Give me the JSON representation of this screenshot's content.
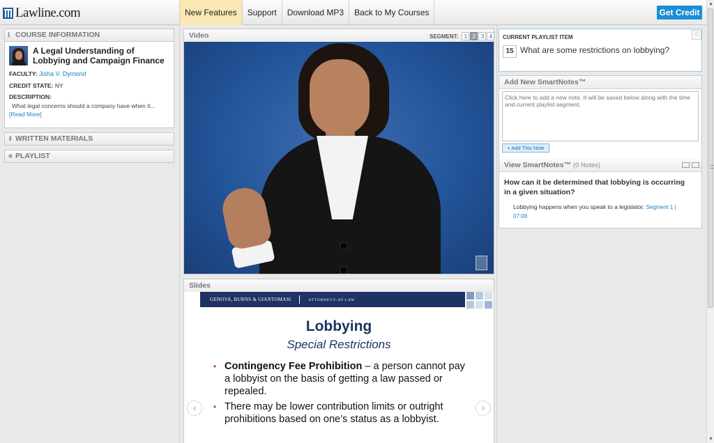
{
  "header": {
    "logo_text": "Lawline.com",
    "nav": [
      "New Features",
      "Support",
      "Download MP3",
      "Back to My Courses"
    ],
    "get_credit": "Get Credit"
  },
  "sidebar": {
    "course_info": {
      "heading": "COURSE INFORMATION",
      "title": "A Legal Understanding of Lobbying and Campaign Finance",
      "faculty_label": "FACULTY:",
      "faculty": "Jisha V. Dymond",
      "credit_label": "CREDIT STATE:",
      "credit_state": "NY",
      "description_label": "DESCRIPTION:",
      "description": "What legal concerns should a company have when it...",
      "read_more": "[Read More]"
    },
    "written_materials": "WRITTEN MATERIALS",
    "playlist": "PLAYLIST"
  },
  "video": {
    "heading": "Video",
    "segment_label": "SEGMENT:",
    "segments": [
      "1",
      "2",
      "3",
      "4"
    ],
    "active_segment": "2"
  },
  "slides": {
    "heading": "Slides",
    "firm": "GENOVA, BURNS & GIANTOMASI",
    "firm_tag": "ATTORNEYS-AT-LAW",
    "title": "Lobbying",
    "subtitle": "Special Restrictions",
    "bullet1_bold": "Contingency Fee Prohibition",
    "bullet1_rest": " – a person cannot pay a lobbyist on the basis of getting a law passed or repealed.",
    "bullet2": "There may be lower contribution limits or outright prohibitions based on one’s status as a lobbyist."
  },
  "playlist_item": {
    "label": "CURRENT PLAYLIST ITEM",
    "number": "15",
    "question": "What are some restrictions on lobbying?"
  },
  "smartnotes": {
    "add_heading": "Add New SmartNotes™",
    "placeholder": "Click here to add a new note. It will be saved below along with the time and current playlist segment.",
    "add_button": "+ Add This Note",
    "view_heading": "View SmartNotes™",
    "view_count": "(0 Notes)",
    "note_question": "How can it be determined that lobbying is occurring in a given situation?",
    "note_answer": "Lobbying happens when you speak to a legislator.",
    "note_link": "Segment 1 | 07:08"
  },
  "colors": {
    "accent": "#1b8fd6",
    "active_tab": "#fbe7b3",
    "slide_navy": "#1e3264"
  }
}
